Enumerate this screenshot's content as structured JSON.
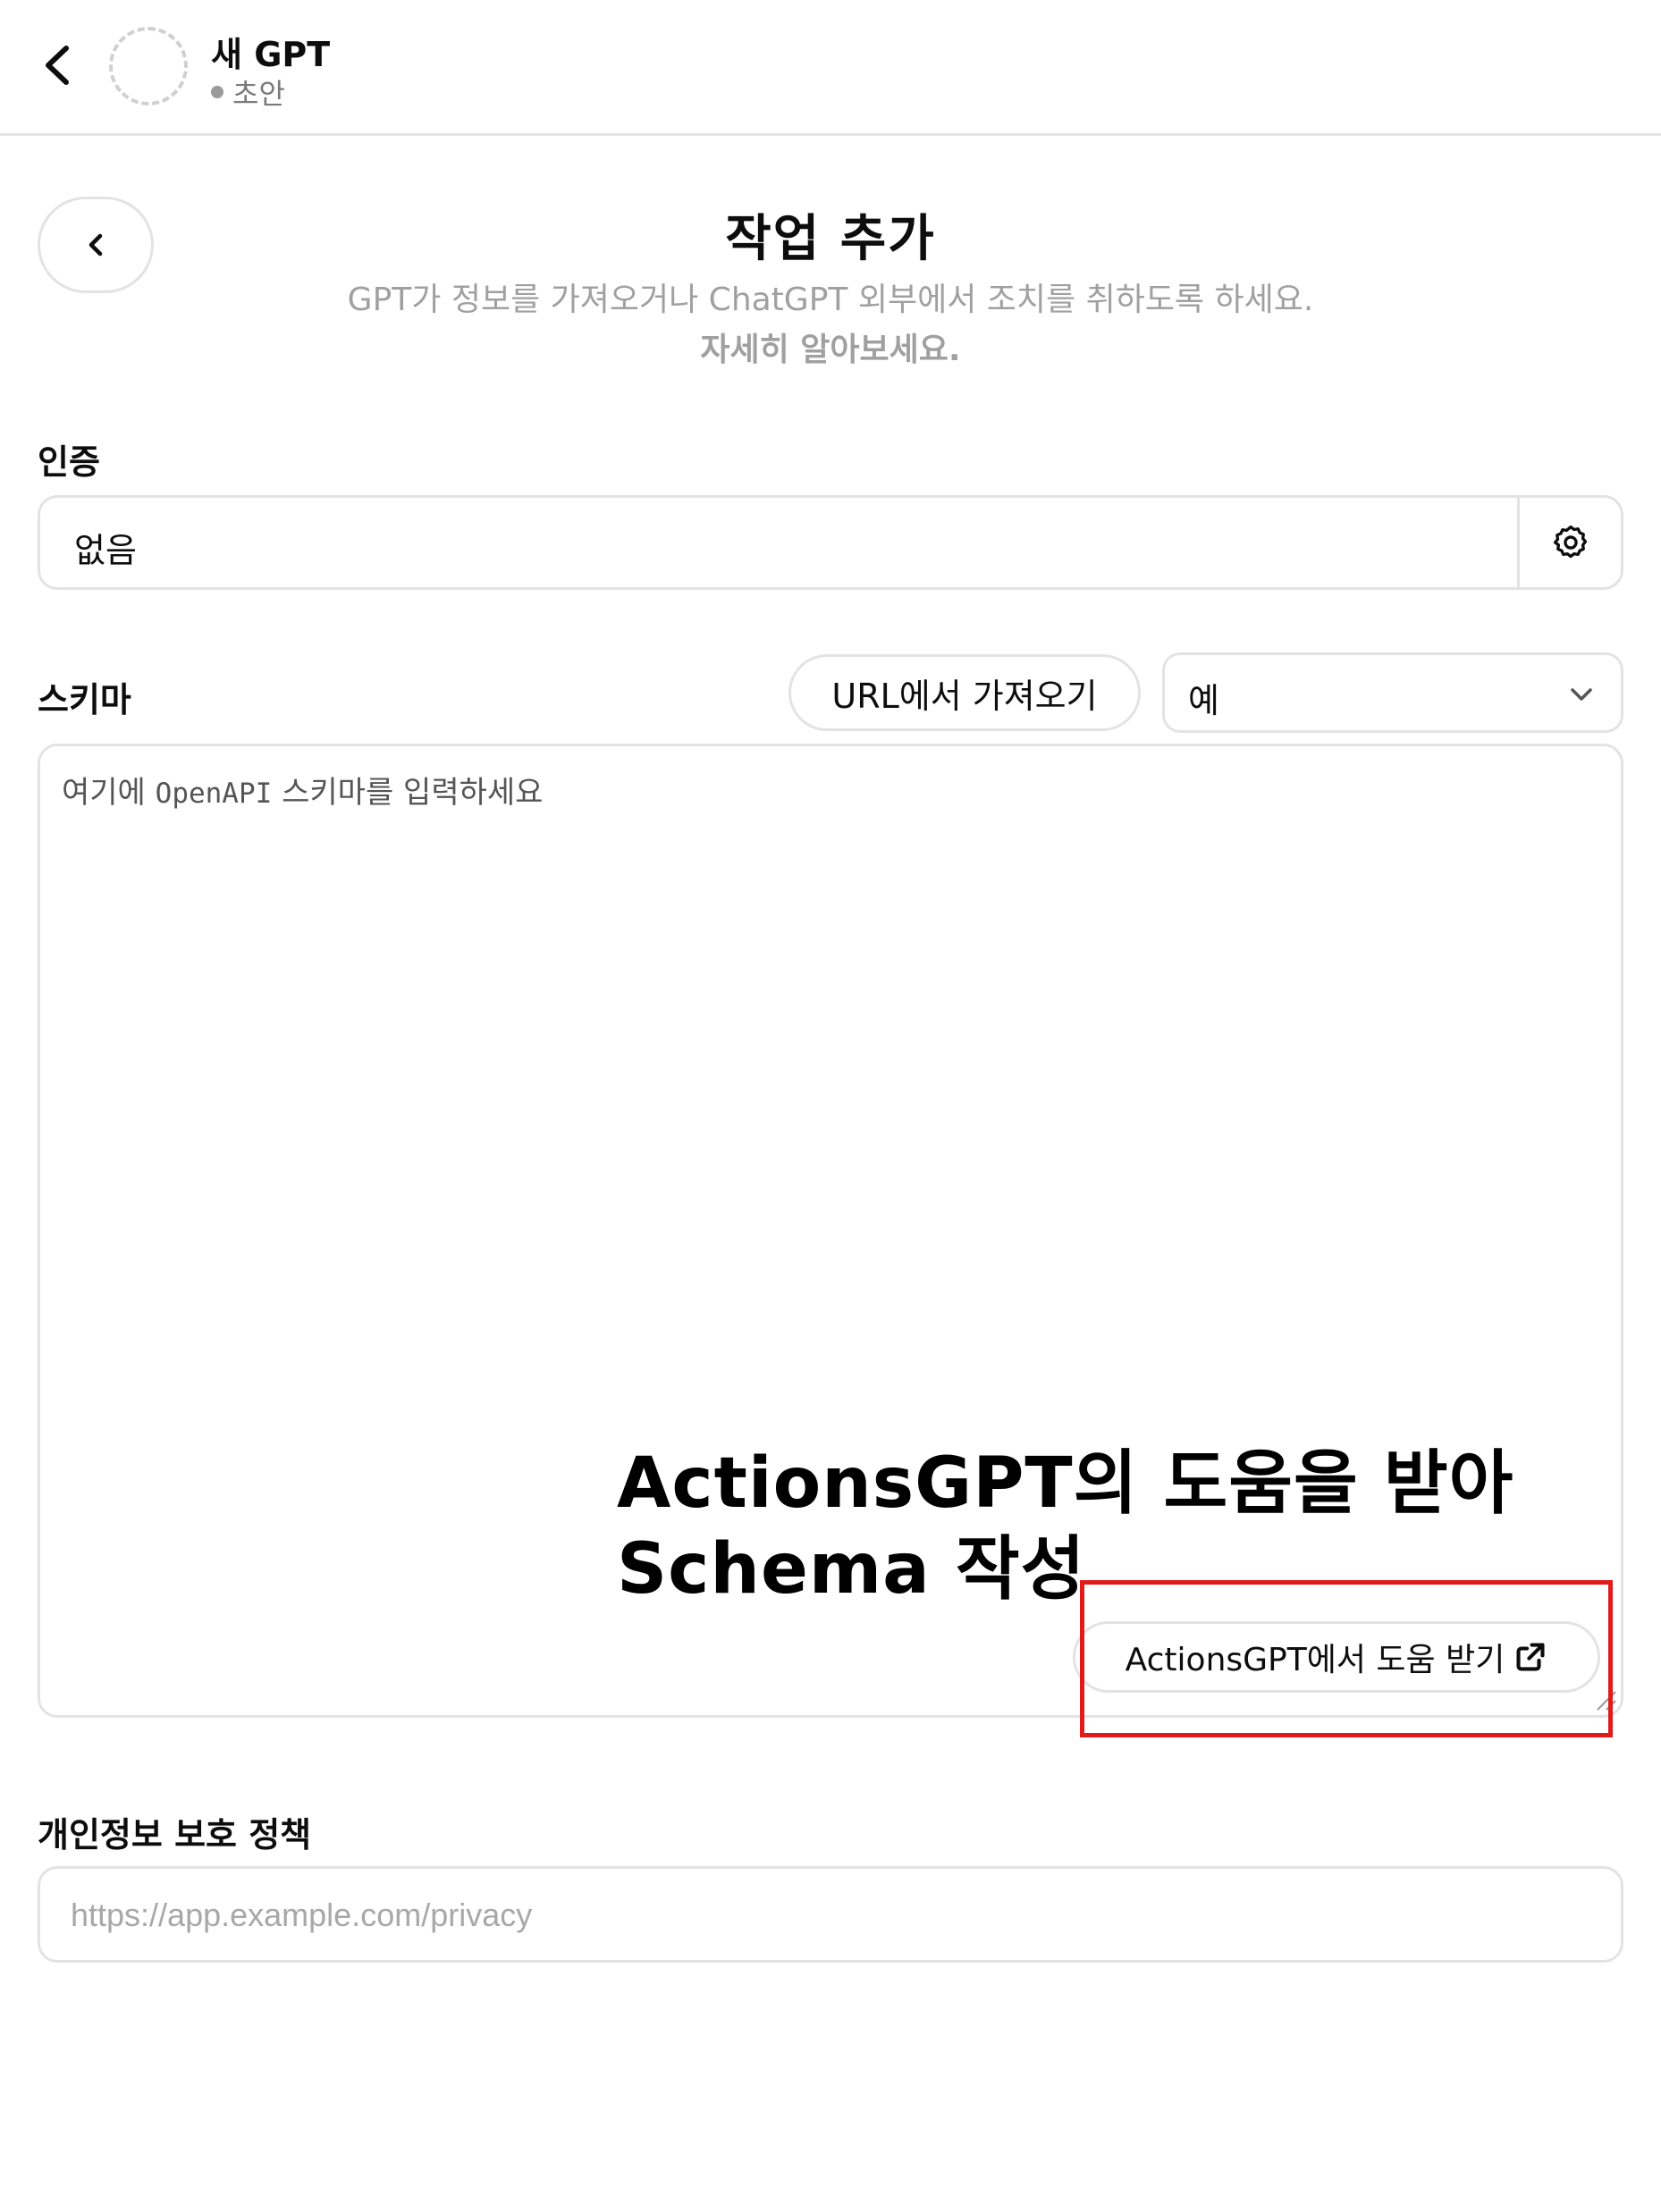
{
  "header": {
    "title": "새 GPT",
    "status": "초안"
  },
  "panel": {
    "heading": "작업 추가",
    "subtitle": "GPT가 정보를 가져오거나 ChatGPT 외부에서 조치를 취하도록 하세요.",
    "learn_more": "자세히 알아보세요."
  },
  "auth": {
    "label": "인증",
    "value": "없음"
  },
  "schema": {
    "label": "스키마",
    "import_button": "URL에서 가져오기",
    "example_select": "예",
    "placeholder_prefix": "여기에 ",
    "placeholder_code": "OpenAPI",
    "placeholder_suffix": " 스키마를 입력하세요",
    "help_button": "ActionsGPT에서 도움 받기"
  },
  "annotation": {
    "line1": "ActionsGPT의 도움을 받아",
    "line2": "Schema 작성",
    "color": "#e11a1a"
  },
  "privacy": {
    "label": "개인정보 보호 정책",
    "placeholder": "https://app.example.com/privacy"
  },
  "icons": [
    "chevron-left-icon",
    "gear-icon",
    "chevron-down-icon",
    "external-link-icon",
    "resize-handle-icon"
  ]
}
